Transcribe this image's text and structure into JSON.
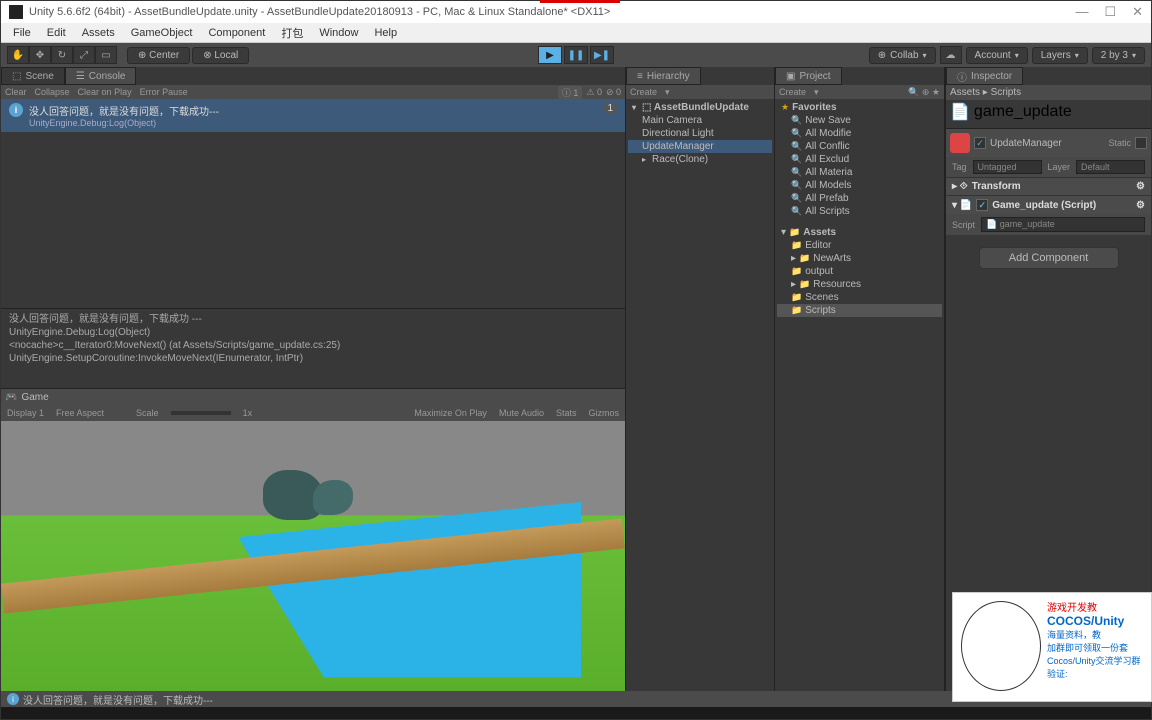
{
  "titlebar": {
    "title": "Unity 5.6.6f2 (64bit) - AssetBundleUpdate.unity - AssetBundleUpdate20180913 - PC, Mac & Linux Standalone* <DX11>"
  },
  "menubar": {
    "items": [
      "File",
      "Edit",
      "Assets",
      "GameObject",
      "Component",
      "打包",
      "Window",
      "Help"
    ]
  },
  "toolbar": {
    "center": "Center",
    "local": "Local",
    "collab": "Collab",
    "account": "Account",
    "layers": "Layers",
    "layout": "2 by 3"
  },
  "tabs": {
    "scene": "Scene",
    "console": "Console",
    "game": "Game",
    "hierarchy": "Hierarchy",
    "project": "Project",
    "inspector": "Inspector"
  },
  "console": {
    "clear": "Clear",
    "collapse": "Collapse",
    "clear_on_play": "Clear on Play",
    "error_pause": "Error Pause",
    "counter": "1",
    "entry_text": "没人回答问题，就是没有问题，下载成功---",
    "entry_sub": "UnityEngine.Debug:Log(Object)",
    "detail_line1": "没人回答问题，就是没有问题，下载成功 ---",
    "detail_line2": "UnityEngine.Debug:Log(Object)",
    "detail_line3": "<nocache>c__Iterator0:MoveNext() (at Assets/Scripts/game_update.cs:25)",
    "detail_line4": "UnityEngine.SetupCoroutine:InvokeMoveNext(IEnumerator, IntPtr)"
  },
  "game": {
    "display": "Display 1",
    "aspect": "Free Aspect",
    "scale": "Scale",
    "scale_val": "1x",
    "maximize": "Maximize On Play",
    "mute": "Mute Audio",
    "stats": "Stats",
    "gizmos": "Gizmos"
  },
  "hierarchy": {
    "create": "Create",
    "root": "AssetBundleUpdate",
    "items": [
      "Main Camera",
      "Directional Light",
      "UpdateManager",
      "Race(Clone)"
    ]
  },
  "project": {
    "create": "Create",
    "breadcrumb": "Assets ▸ Scripts",
    "favorites": "Favorites",
    "fav_items": [
      "New Save",
      "All Modifie",
      "All Conflic",
      "All Exclud",
      "All Materia",
      "All Models",
      "All Prefab",
      "All Scripts"
    ],
    "assets": "Assets",
    "asset_folders": [
      "Editor",
      "NewArts",
      "output",
      "Resources",
      "Scenes",
      "Scripts"
    ],
    "file": "game_update"
  },
  "inspector": {
    "name": "UpdateManager",
    "static": "Static",
    "tag_label": "Tag",
    "tag_value": "Untagged",
    "layer_label": "Layer",
    "layer_value": "Default",
    "transform": "Transform",
    "component": "Game_update (Script)",
    "script_label": "Script",
    "script_value": "game_update",
    "add": "Add Component"
  },
  "status": {
    "text": "没人回答问题，就是没有问题，下载成功---"
  },
  "overlay": {
    "line1": "游戏开发教",
    "line2": "COCOS/Unity",
    "line3": "海量资料，教",
    "line4": "加群即可领取一份套",
    "line5": "Cocos/Unity交流学习群",
    "line6": "验证:"
  }
}
